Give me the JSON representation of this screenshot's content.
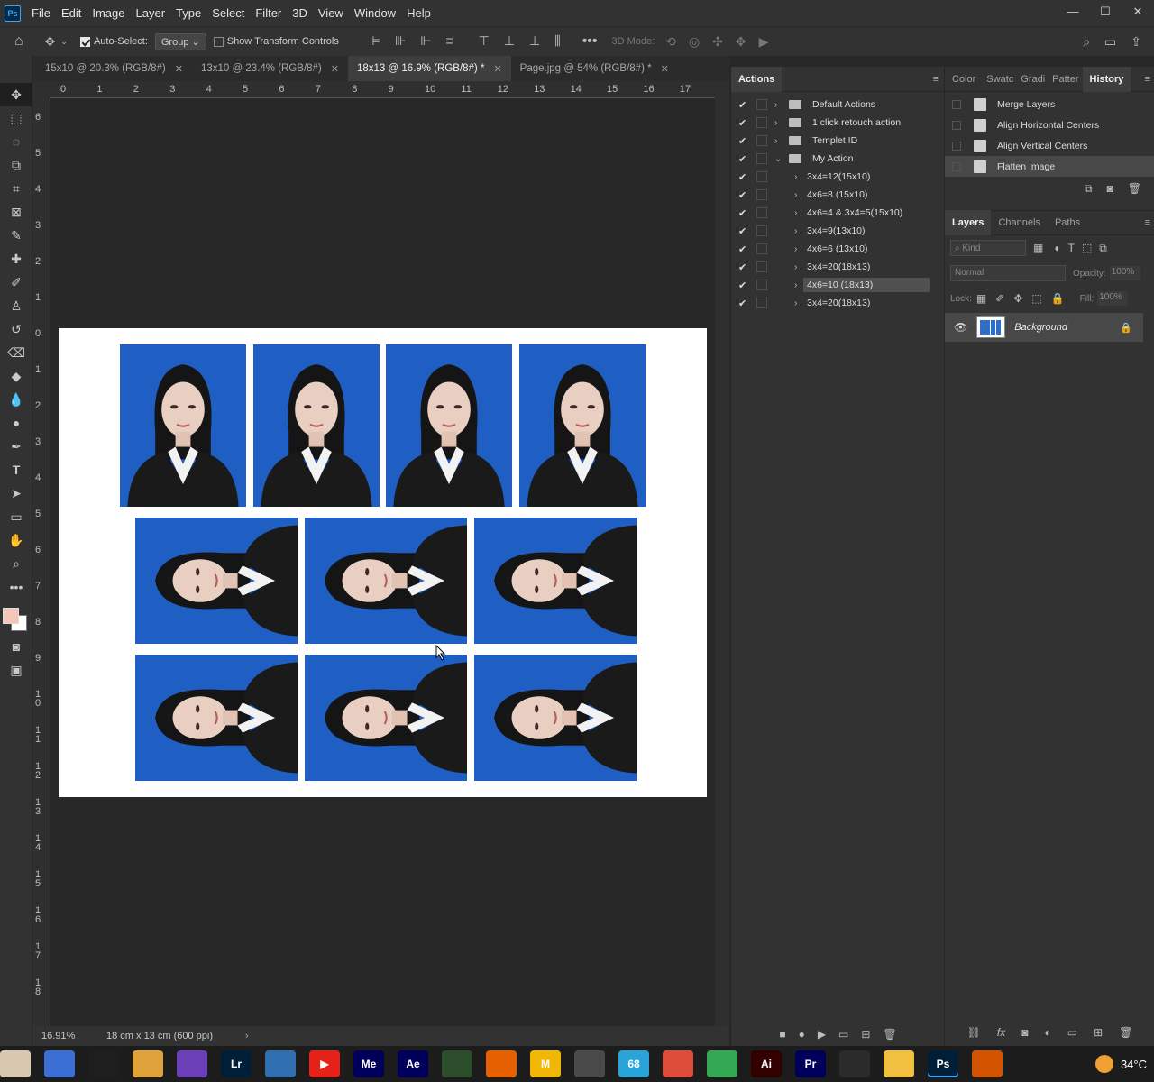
{
  "app": {
    "logo": "Ps"
  },
  "menu": [
    "File",
    "Edit",
    "Image",
    "Layer",
    "Type",
    "Select",
    "Filter",
    "3D",
    "View",
    "Window",
    "Help"
  ],
  "window_controls": [
    "—",
    "☐",
    "✕"
  ],
  "options": {
    "auto_select_label": "Auto-Select:",
    "auto_select_checked": true,
    "auto_select_value": "Group",
    "show_transform_label": "Show Transform Controls",
    "show_transform_checked": false,
    "mode_3d_label": "3D Mode:"
  },
  "tabs": [
    {
      "label": "15x10 @ 20.3% (RGB/8#)",
      "active": false
    },
    {
      "label": "13x10 @ 23.4% (RGB/8#)",
      "active": false
    },
    {
      "label": "18x13 @ 16.9% (RGB/8#) *",
      "active": true
    },
    {
      "label": "Page.jpg @ 54% (RGB/8#) *",
      "active": false
    }
  ],
  "ruler_h": [
    "0",
    "1",
    "2",
    "3",
    "4",
    "5",
    "6",
    "7",
    "8",
    "9",
    "10",
    "11",
    "12",
    "13",
    "14",
    "15",
    "16",
    "17",
    "1"
  ],
  "ruler_v": [
    "6",
    "5",
    "4",
    "3",
    "2",
    "1",
    "0",
    "1",
    "2",
    "3",
    "4",
    "5",
    "6",
    "7",
    "8",
    "9",
    "10",
    "11",
    "12",
    "13",
    "14",
    "15",
    "16",
    "17",
    "18"
  ],
  "status": {
    "zoom": "16.91%",
    "doc_info": "18 cm x 13 cm (600 ppi)"
  },
  "actions_panel": {
    "title": "Actions",
    "items": [
      {
        "label": "Default Actions",
        "type": "set",
        "expanded": false
      },
      {
        "label": "1 click retouch action",
        "type": "set",
        "expanded": false
      },
      {
        "label": "Templet ID",
        "type": "set",
        "expanded": false
      },
      {
        "label": "My Action",
        "type": "set",
        "expanded": true
      },
      {
        "label": "3x4=12(15x10)",
        "type": "action"
      },
      {
        "label": "4x6=8 (15x10)",
        "type": "action"
      },
      {
        "label": "4x6=4 & 3x4=5(15x10)",
        "type": "action"
      },
      {
        "label": "3x4=9(13x10)",
        "type": "action"
      },
      {
        "label": "4x6=6 (13x10)",
        "type": "action"
      },
      {
        "label": "3x4=20(18x13)",
        "type": "action"
      },
      {
        "label": "4x6=10 (18x13)",
        "type": "action",
        "selected": true
      },
      {
        "label": "3x4=20(18x13)",
        "type": "action"
      }
    ]
  },
  "top_right_tabs": [
    "Color",
    "Swatc",
    "Gradi",
    "Patter",
    "History"
  ],
  "history": [
    "Merge Layers",
    "Align Horizontal Centers",
    "Align Vertical Centers",
    "Flatten Image"
  ],
  "layers_tabs": [
    "Layers",
    "Channels",
    "Paths"
  ],
  "layers": {
    "kind_label": "Kind",
    "blend_mode": "Normal",
    "opacity_label": "Opacity:",
    "opacity": "100%",
    "lock_label": "Lock:",
    "fill_label": "Fill:",
    "fill": "100%",
    "items": [
      {
        "name": "Background",
        "visible": true,
        "locked": true
      }
    ]
  },
  "taskbar": {
    "temperature": "34°C",
    "apps": [
      {
        "name": "copilot-icon",
        "color": "#3b6fd6",
        "text": ""
      },
      {
        "name": "vscode-icon",
        "color": "#1e1e1e",
        "text": ""
      },
      {
        "name": "files-icon",
        "color": "#e0a23a",
        "text": ""
      },
      {
        "name": "video-editor-icon",
        "color": "#6a3fb8",
        "text": ""
      },
      {
        "name": "lightroom-icon",
        "color": "#001e36",
        "text": "Lr"
      },
      {
        "name": "search-tool-icon",
        "color": "#2f6fb0",
        "text": ""
      },
      {
        "name": "youtube-icon",
        "color": "#e62117",
        "text": "▶"
      },
      {
        "name": "media-encoder-icon",
        "color": "#00005b",
        "text": "Me"
      },
      {
        "name": "after-effects-icon",
        "color": "#00005b",
        "text": "Ae"
      },
      {
        "name": "grid-app-icon",
        "color": "#2b4d2b",
        "text": ""
      },
      {
        "name": "firefox-icon",
        "color": "#e66000",
        "text": ""
      },
      {
        "name": "m-app-icon",
        "color": "#f2b705",
        "text": "M"
      },
      {
        "name": "paint-app-icon",
        "color": "#4a4a4a",
        "text": ""
      },
      {
        "name": "telegram-icon",
        "color": "#2aa3d8",
        "text": "68"
      },
      {
        "name": "chrome-icon",
        "color": "#dd4b39",
        "text": ""
      },
      {
        "name": "chrome-profile-icon",
        "color": "#34a853",
        "text": ""
      },
      {
        "name": "illustrator-icon",
        "color": "#330000",
        "text": "Ai"
      },
      {
        "name": "premiere-icon",
        "color": "#00005b",
        "text": "Pr"
      },
      {
        "name": "target-app-icon",
        "color": "#2b2b2b",
        "text": ""
      },
      {
        "name": "explorer-icon",
        "color": "#f0c040",
        "text": ""
      },
      {
        "name": "photoshop-icon",
        "color": "#001e36",
        "text": "Ps"
      },
      {
        "name": "document-app-icon",
        "color": "#d35400",
        "text": ""
      }
    ]
  },
  "colors": {
    "foreground": "#f0c7b8",
    "background": "#ffffff"
  }
}
